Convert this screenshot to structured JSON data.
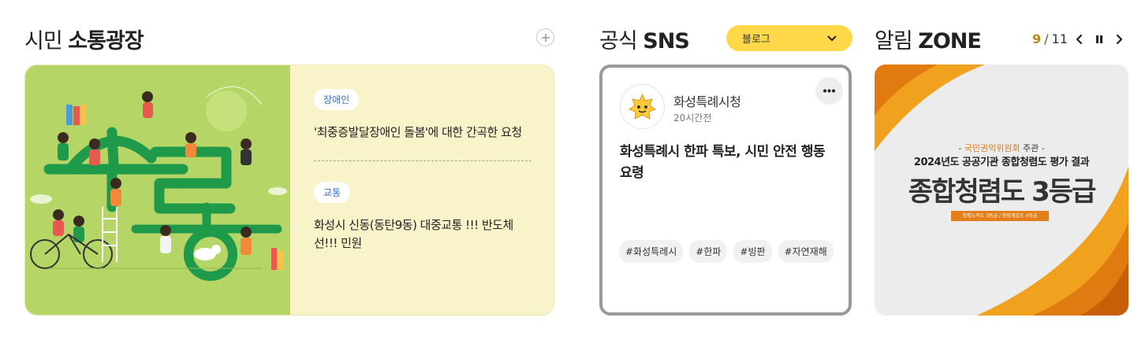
{
  "citizen_square": {
    "title_light": "시민",
    "title_bold": "소통광장",
    "items": [
      {
        "badge": "장애인",
        "text": "'최중증발달장애인 돌봄'에 대한 간곡한 요청"
      },
      {
        "badge": "교통",
        "text": "화성시 신동(동탄9동) 대중교통 !!! 반도체선!!! 민원"
      }
    ]
  },
  "official_sns": {
    "title_light": "공식",
    "title_bold": "SNS",
    "select_value": "블로그",
    "post": {
      "account": "화성특례시청",
      "time": "20시간전",
      "text": "화성특례시 한파 특보, 시민 안전 행동요령",
      "tags": [
        "#화성특례시",
        "#한파",
        "#빙판",
        "#자연재해"
      ]
    }
  },
  "alert_zone": {
    "title_light": "알림",
    "title_bold": "ZONE",
    "pager": {
      "current": "9",
      "total": "11"
    },
    "banner": {
      "org": "국민권익위원회",
      "org_suffix": "주관",
      "subtitle": "2024년도 공공기관 종합청렴도 평가 결과",
      "headline": "종합청렴도 3등급",
      "strip": "청렴노력도 3등급 / 청렴체감도 4등급"
    }
  },
  "colors": {
    "illustration_green": "#b5d566",
    "card_cream": "#f8f3c8",
    "badge_blue": "#3a6fc7",
    "select_yellow": "#ffd84a",
    "pager_gold": "#b8861a",
    "banner_orange": "#e27f1b"
  },
  "icons": {
    "plus": "plus-icon",
    "select": "chevron-down-icon",
    "more": "more-dots-icon",
    "prev": "chevron-left-icon",
    "pause": "pause-icon",
    "next": "chevron-right-icon"
  }
}
